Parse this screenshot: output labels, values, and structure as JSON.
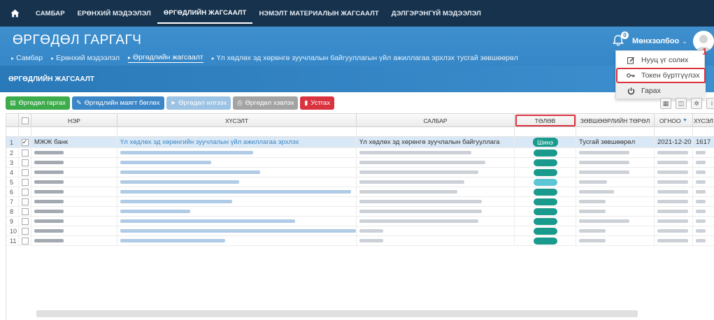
{
  "topnav": {
    "items": [
      "САМБАР",
      "ЕРӨНХИЙ МЭДЭЭЛЭЛ",
      "ӨРГӨДЛИЙН ЖАГСААЛТ",
      "НЭМЭЛТ МАТЕРИАЛЫН ЖАГСААЛТ",
      "ДЭЛГЭРЭНГҮЙ МЭДЭЭЛЭЛ"
    ],
    "active_index": 2,
    "icons": {
      "home": "home-icon"
    }
  },
  "header": {
    "title": "ӨРГӨДӨЛ ГАРГАГЧ",
    "breadcrumbs": [
      "Самбар",
      "Ерөнхий мэдээлэл",
      "Өргөдлийн жагсаалт",
      "Үл хөдлөх эд хөрөнгө зуучлалын байгууллагын үйл ажиллагаа эрхлэх тусгай зөвшөөрөл"
    ],
    "active_breadcrumb": 2,
    "section_title": "ӨРГӨДЛИЙН ЖАГСААЛТ"
  },
  "user": {
    "notification_count": "0",
    "name": "Мөнхзолбоо",
    "menu": [
      {
        "label": "Нууц үг солих",
        "icon": "edit-icon"
      },
      {
        "label": "Токен бүртгүүлэх",
        "icon": "key-icon",
        "highlighted": true
      },
      {
        "label": "Гарах",
        "icon": "power-icon"
      }
    ],
    "callout": "1"
  },
  "toolbar": {
    "buttons": [
      {
        "label": "Өргөдөл гаргах",
        "color": "green",
        "icon": "document-icon"
      },
      {
        "label": "Өргөдлийн маягт бөглөх",
        "color": "blue",
        "icon": "edit-icon"
      },
      {
        "label": "Өргөдөл илгээх",
        "color": "lightblue",
        "icon": "send-icon"
      },
      {
        "label": "Өргөдөл хэвлэх",
        "color": "gray",
        "icon": "print-icon"
      },
      {
        "label": "Устгах",
        "color": "red",
        "icon": "trash-icon"
      }
    ],
    "right_tools": [
      "export-icon",
      "columns-icon",
      "settings-icon",
      "info-icon"
    ],
    "right_tool_labels": [
      "",
      "",
      "",
      "i"
    ]
  },
  "grid": {
    "columns": [
      "НЭР",
      "ХҮСЭЛТ",
      "САЛБАР",
      "ТӨЛӨВ",
      "ЗӨВШӨӨРЛИЙН ТӨРӨЛ",
      "ОГНОО",
      "ХҮСЭЛ"
    ],
    "sort_indicator": "▼",
    "highlighted_column": "ТӨЛӨВ",
    "rows": [
      {
        "num": "1",
        "checked": true,
        "name": "МЖЖ банк",
        "request": "Үл хөдлөх эд хөрөнгийн зуучлалын үйл ажиллагаа эрхлэх",
        "sector": "Үл хөдлөх эд хөрөнгө зуучлалын байгууллага",
        "status": "Шинэ",
        "permit_type": "Тусгай зөвшөөрөл",
        "date": "2021-12-20",
        "extra": "1617"
      },
      {
        "num": "2"
      },
      {
        "num": "3"
      },
      {
        "num": "4"
      },
      {
        "num": "5"
      },
      {
        "num": "6"
      },
      {
        "num": "7"
      },
      {
        "num": "8"
      },
      {
        "num": "9"
      },
      {
        "num": "10"
      },
      {
        "num": "11"
      }
    ]
  },
  "colors": {
    "nav_bg": "#17324d",
    "header_bg": "#3f8fcd",
    "status_pill": "#1a9a8c",
    "highlight": "#d9333f"
  }
}
